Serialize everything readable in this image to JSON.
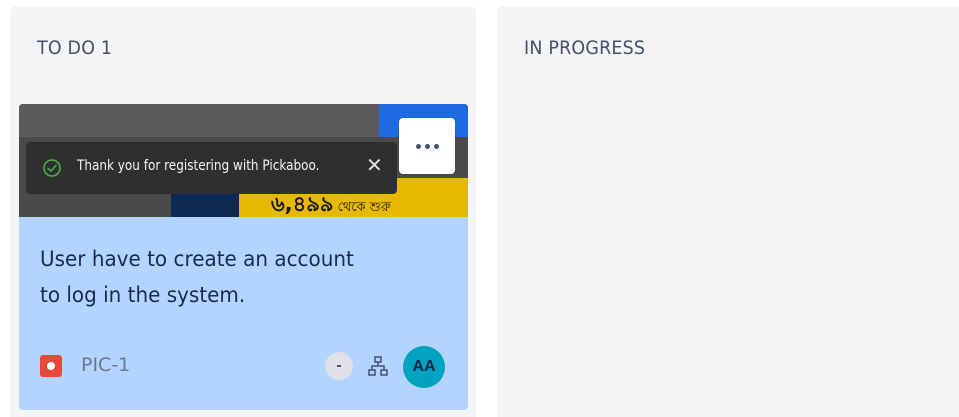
{
  "columns": [
    {
      "title": "TO DO 1"
    },
    {
      "title": "IN PROGRESS"
    }
  ],
  "card": {
    "cover": {
      "price_text": "৬,৪৯৯",
      "price_suffix": "থেকে শুরু",
      "toast_text": "Thank you for registering with Pickaboo.",
      "toast_close": "✕"
    },
    "summary_line1": "User have to create an account",
    "summary_line2": "to log in the system.",
    "issue_key": "PIC-1",
    "estimate": "-",
    "assignee_initials": "AA",
    "icons": {
      "issue_type": "bug-icon",
      "hierarchy": "hierarchy-icon",
      "more": "more-icon",
      "toast_check": "check-circle-icon"
    }
  },
  "colors": {
    "column_bg": "#f4f5f7",
    "card_bg": "#b3d4ff",
    "bug": "#e5493a",
    "avatar": "#00a3bf",
    "header_text": "#42526e"
  }
}
